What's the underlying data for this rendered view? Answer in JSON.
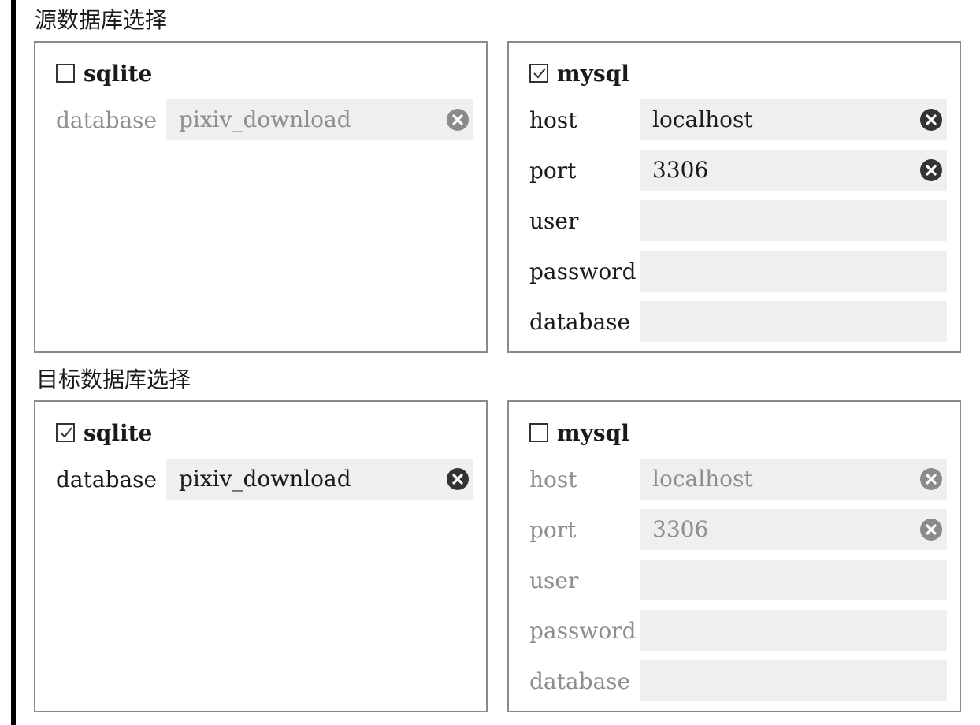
{
  "source": {
    "title": "源数据库选择",
    "sqlite": {
      "checkbox_label": "sqlite",
      "checked": false,
      "fields": [
        {
          "label": "database",
          "value": "pixiv_download"
        }
      ]
    },
    "mysql": {
      "checkbox_label": "mysql",
      "checked": true,
      "fields": [
        {
          "label": "host",
          "value": "localhost"
        },
        {
          "label": "port",
          "value": "3306"
        },
        {
          "label": "user",
          "value": ""
        },
        {
          "label": "password",
          "value": ""
        },
        {
          "label": "database",
          "value": ""
        }
      ]
    }
  },
  "target": {
    "title": "目标数据库选择",
    "sqlite": {
      "checkbox_label": "sqlite",
      "checked": true,
      "fields": [
        {
          "label": "database",
          "value": "pixiv_download"
        }
      ]
    },
    "mysql": {
      "checkbox_label": "mysql",
      "checked": false,
      "fields": [
        {
          "label": "host",
          "value": "localhost"
        },
        {
          "label": "port",
          "value": "3306"
        },
        {
          "label": "user",
          "value": ""
        },
        {
          "label": "password",
          "value": ""
        },
        {
          "label": "database",
          "value": ""
        }
      ]
    }
  },
  "icons": {
    "checkbox_checked": "checkmark-icon",
    "clear": "clear-icon"
  },
  "colors": {
    "input_bg": "#efefef",
    "border": "#8a8a8a",
    "disabled_text": "#8e8e8e"
  }
}
